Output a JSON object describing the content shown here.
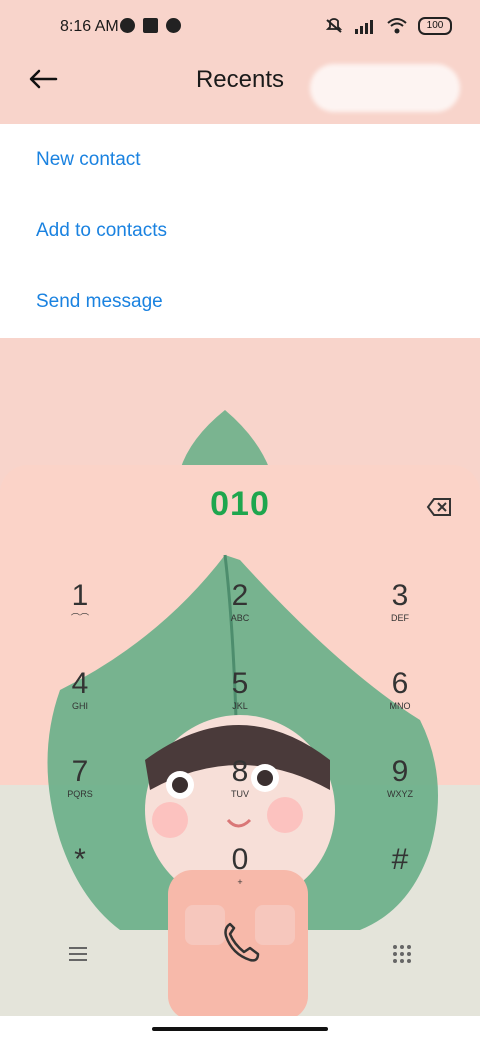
{
  "status": {
    "time": "8:16 AM",
    "battery": "100"
  },
  "header": {
    "title": "Recents",
    "back": "Back"
  },
  "menu": {
    "items": [
      "New contact",
      "Add to contacts",
      "Send message"
    ]
  },
  "dialer": {
    "number": "010",
    "keys": [
      {
        "digit": "1",
        "sub": "voicemail"
      },
      {
        "digit": "2",
        "sub": "ABC"
      },
      {
        "digit": "3",
        "sub": "DEF"
      },
      {
        "digit": "4",
        "sub": "GHI"
      },
      {
        "digit": "5",
        "sub": "JKL"
      },
      {
        "digit": "6",
        "sub": "MNO"
      },
      {
        "digit": "7",
        "sub": "PQRS"
      },
      {
        "digit": "8",
        "sub": "TUV"
      },
      {
        "digit": "9",
        "sub": "WXYZ"
      },
      {
        "digit": "*",
        "sub": ""
      },
      {
        "digit": "0",
        "sub": "+"
      },
      {
        "digit": "#",
        "sub": ""
      }
    ]
  }
}
